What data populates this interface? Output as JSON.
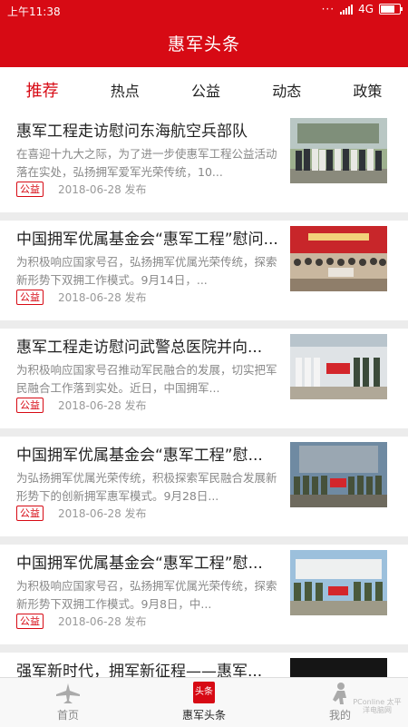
{
  "status": {
    "time": "上午11:38",
    "network": "4G"
  },
  "app": {
    "title": "惠军头条"
  },
  "tabs": [
    "推荐",
    "热点",
    "公益",
    "动态",
    "政策"
  ],
  "articles": [
    {
      "title": "惠军工程走访慰问东海航空兵部队",
      "summary": "在喜迎十九大之际，为了进一步使惠军工程公益活动落在实处，弘扬拥军爱军光荣传统，10...",
      "tag": "公益",
      "date": "2018-06-28 发布"
    },
    {
      "title": "中国拥军优属基金会“惠军工程”慰问...",
      "summary": "为积极响应国家号召，弘扬拥军优属光荣传统，探索新形势下双拥工作模式。9月14日，...",
      "tag": "公益",
      "date": "2018-06-28 发布"
    },
    {
      "title": "惠军工程走访慰问武警总医院并向...",
      "summary": "为积极响应国家号召推动军民融合的发展，切实把军民融合工作落到实处。近日，中国拥军...",
      "tag": "公益",
      "date": "2018-06-28 发布"
    },
    {
      "title": "中国拥军优属基金会“惠军工程”慰...",
      "summary": "为弘扬拥军优属光荣传统，积极探索军民融合发展新形势下的创新拥军惠军模式。9月28日...",
      "tag": "公益",
      "date": "2018-06-28 发布"
    },
    {
      "title": "中国拥军优属基金会“惠军工程”慰...",
      "summary": "为积极响应国家号召，弘扬拥军优属光荣传统，探索新形势下双拥工作模式。9月8日，中...",
      "tag": "公益",
      "date": "2018-06-28 发布"
    },
    {
      "title": "强军新时代，拥军新征程——惠军..."
    }
  ],
  "bottom_nav": {
    "home": "首页",
    "news": "惠军头条",
    "news_icon_text": "头条",
    "mine": "我的",
    "watermark": "PConline 太平洋电脑网"
  },
  "colors": {
    "brand": "#d70a14"
  }
}
